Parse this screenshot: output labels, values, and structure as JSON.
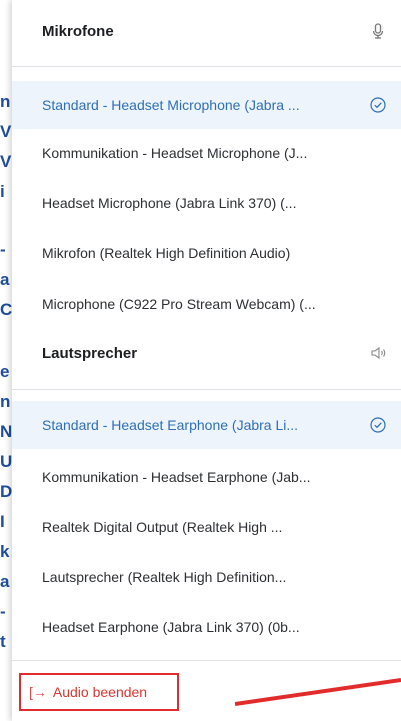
{
  "background_fragments": [
    "n",
    "V",
    "V",
    "i",
    "-",
    "a",
    "C",
    "e",
    "n",
    "N",
    "U",
    "D",
    "I",
    "k",
    "a",
    "-",
    "t"
  ],
  "microphones": {
    "title": "Mikrofone",
    "icon": "microphone-icon",
    "items": [
      {
        "label": "Standard - Headset Microphone (Jabra ...",
        "selected": true
      },
      {
        "label": "Kommunikation - Headset Microphone (J...",
        "selected": false
      },
      {
        "label": "Headset Microphone (Jabra Link 370) (...",
        "selected": false
      },
      {
        "label": "Mikrofon (Realtek High Definition Audio)",
        "selected": false
      },
      {
        "label": "Microphone (C922 Pro Stream Webcam) (...",
        "selected": false
      }
    ]
  },
  "speakers": {
    "title": "Lautsprecher",
    "icon": "speaker-icon",
    "items": [
      {
        "label": "Standard - Headset Earphone (Jabra Li...",
        "selected": true
      },
      {
        "label": "Kommunikation - Headset Earphone (Jab...",
        "selected": false
      },
      {
        "label": "Realtek Digital Output (Realtek High ...",
        "selected": false
      },
      {
        "label": "Lautsprecher (Realtek High Definition...",
        "selected": false
      },
      {
        "label": "Headset Earphone (Jabra Link 370) (0b...",
        "selected": false
      }
    ]
  },
  "footer": {
    "end_audio_label": "Audio beenden",
    "exit_icon": "[→"
  },
  "colors": {
    "accent": "#2e6fb7",
    "selected_bg": "#eef4fb",
    "danger": "#d9362f",
    "annotation": "#e22b2b"
  }
}
